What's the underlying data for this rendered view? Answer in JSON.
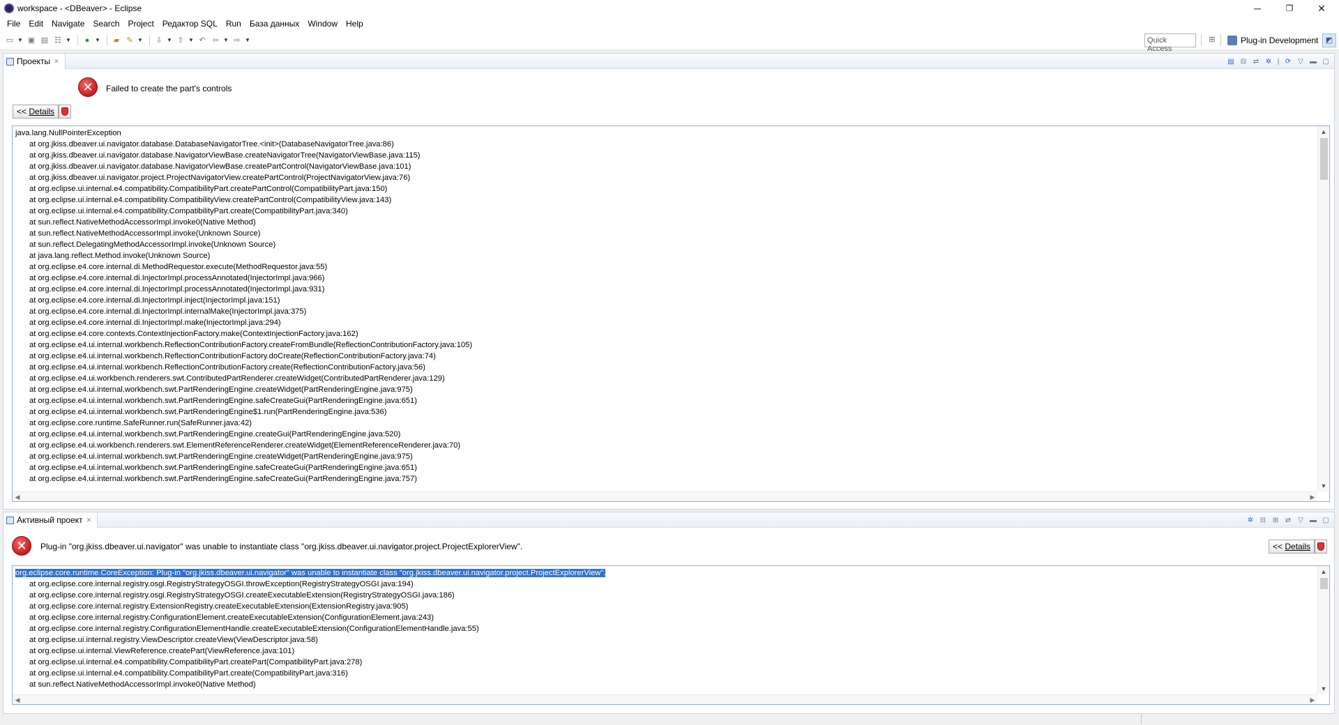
{
  "window": {
    "title": "workspace - <DBeaver> - Eclipse",
    "minimize_glyph": "─",
    "restore_glyph": "❐",
    "close_glyph": "✕"
  },
  "menu": [
    "File",
    "Edit",
    "Navigate",
    "Search",
    "Project",
    "Редактор SQL",
    "Run",
    "База данных",
    "Window",
    "Help"
  ],
  "toolbar": {
    "quick_access_label": "Quick Access",
    "perspective_label": "Plug-in Development"
  },
  "top_view": {
    "tab_label": "Проекты",
    "error_message": "Failed to create the part's controls",
    "details_prefix": "<< ",
    "details_label": "Details",
    "trace_first_line": "java.lang.NullPointerException",
    "trace_lines": [
      "at org.jkiss.dbeaver.ui.navigator.database.DatabaseNavigatorTree.<init>(DatabaseNavigatorTree.java:86)",
      "at org.jkiss.dbeaver.ui.navigator.database.NavigatorViewBase.createNavigatorTree(NavigatorViewBase.java:115)",
      "at org.jkiss.dbeaver.ui.navigator.database.NavigatorViewBase.createPartControl(NavigatorViewBase.java:101)",
      "at org.jkiss.dbeaver.ui.navigator.project.ProjectNavigatorView.createPartControl(ProjectNavigatorView.java:76)",
      "at org.eclipse.ui.internal.e4.compatibility.CompatibilityPart.createPartControl(CompatibilityPart.java:150)",
      "at org.eclipse.ui.internal.e4.compatibility.CompatibilityView.createPartControl(CompatibilityView.java:143)",
      "at org.eclipse.ui.internal.e4.compatibility.CompatibilityPart.create(CompatibilityPart.java:340)",
      "at sun.reflect.NativeMethodAccessorImpl.invoke0(Native Method)",
      "at sun.reflect.NativeMethodAccessorImpl.invoke(Unknown Source)",
      "at sun.reflect.DelegatingMethodAccessorImpl.invoke(Unknown Source)",
      "at java.lang.reflect.Method.invoke(Unknown Source)",
      "at org.eclipse.e4.core.internal.di.MethodRequestor.execute(MethodRequestor.java:55)",
      "at org.eclipse.e4.core.internal.di.InjectorImpl.processAnnotated(InjectorImpl.java:966)",
      "at org.eclipse.e4.core.internal.di.InjectorImpl.processAnnotated(InjectorImpl.java:931)",
      "at org.eclipse.e4.core.internal.di.InjectorImpl.inject(InjectorImpl.java:151)",
      "at org.eclipse.e4.core.internal.di.InjectorImpl.internalMake(InjectorImpl.java:375)",
      "at org.eclipse.e4.core.internal.di.InjectorImpl.make(InjectorImpl.java:294)",
      "at org.eclipse.e4.core.contexts.ContextInjectionFactory.make(ContextInjectionFactory.java:162)",
      "at org.eclipse.e4.ui.internal.workbench.ReflectionContributionFactory.createFromBundle(ReflectionContributionFactory.java:105)",
      "at org.eclipse.e4.ui.internal.workbench.ReflectionContributionFactory.doCreate(ReflectionContributionFactory.java:74)",
      "at org.eclipse.e4.ui.internal.workbench.ReflectionContributionFactory.create(ReflectionContributionFactory.java:56)",
      "at org.eclipse.e4.ui.workbench.renderers.swt.ContributedPartRenderer.createWidget(ContributedPartRenderer.java:129)",
      "at org.eclipse.e4.ui.internal.workbench.swt.PartRenderingEngine.createWidget(PartRenderingEngine.java:975)",
      "at org.eclipse.e4.ui.internal.workbench.swt.PartRenderingEngine.safeCreateGui(PartRenderingEngine.java:651)",
      "at org.eclipse.e4.ui.internal.workbench.swt.PartRenderingEngine$1.run(PartRenderingEngine.java:536)",
      "at org.eclipse.core.runtime.SafeRunner.run(SafeRunner.java:42)",
      "at org.eclipse.e4.ui.internal.workbench.swt.PartRenderingEngine.createGui(PartRenderingEngine.java:520)",
      "at org.eclipse.e4.ui.workbench.renderers.swt.ElementReferenceRenderer.createWidget(ElementReferenceRenderer.java:70)",
      "at org.eclipse.e4.ui.internal.workbench.swt.PartRenderingEngine.createWidget(PartRenderingEngine.java:975)",
      "at org.eclipse.e4.ui.internal.workbench.swt.PartRenderingEngine.safeCreateGui(PartRenderingEngine.java:651)",
      "at org.eclipse.e4.ui.internal.workbench.swt.PartRenderingEngine.safeCreateGui(PartRenderingEngine.java:757)"
    ]
  },
  "bottom_view": {
    "tab_label": "Активный проект",
    "error_message": "Plug-in \"org.jkiss.dbeaver.ui.navigator\" was unable to instantiate class \"org.jkiss.dbeaver.ui.navigator.project.ProjectExplorerView\".",
    "details_prefix": "<< ",
    "details_label": "Details",
    "trace_first_line": "org.eclipse.core.runtime.CoreException: Plug-in \"org.jkiss.dbeaver.ui.navigator\" was unable to instantiate class \"org.jkiss.dbeaver.ui.navigator.project.ProjectExplorerView\".",
    "trace_lines": [
      "at org.eclipse.core.internal.registry.osgi.RegistryStrategyOSGI.throwException(RegistryStrategyOSGI.java:194)",
      "at org.eclipse.core.internal.registry.osgi.RegistryStrategyOSGI.createExecutableExtension(RegistryStrategyOSGI.java:186)",
      "at org.eclipse.core.internal.registry.ExtensionRegistry.createExecutableExtension(ExtensionRegistry.java:905)",
      "at org.eclipse.core.internal.registry.ConfigurationElement.createExecutableExtension(ConfigurationElement.java:243)",
      "at org.eclipse.core.internal.registry.ConfigurationElementHandle.createExecutableExtension(ConfigurationElementHandle.java:55)",
      "at org.eclipse.ui.internal.registry.ViewDescriptor.createView(ViewDescriptor.java:58)",
      "at org.eclipse.ui.internal.ViewReference.createPart(ViewReference.java:101)",
      "at org.eclipse.ui.internal.e4.compatibility.CompatibilityPart.createPart(CompatibilityPart.java:278)",
      "at org.eclipse.ui.internal.e4.compatibility.CompatibilityPart.create(CompatibilityPart.java:316)",
      "at sun.reflect.NativeMethodAccessorImpl.invoke0(Native Method)"
    ]
  },
  "colors": {
    "selection": "#2f72d4",
    "error": "#c91c1c",
    "border": "#8fb0d8"
  }
}
